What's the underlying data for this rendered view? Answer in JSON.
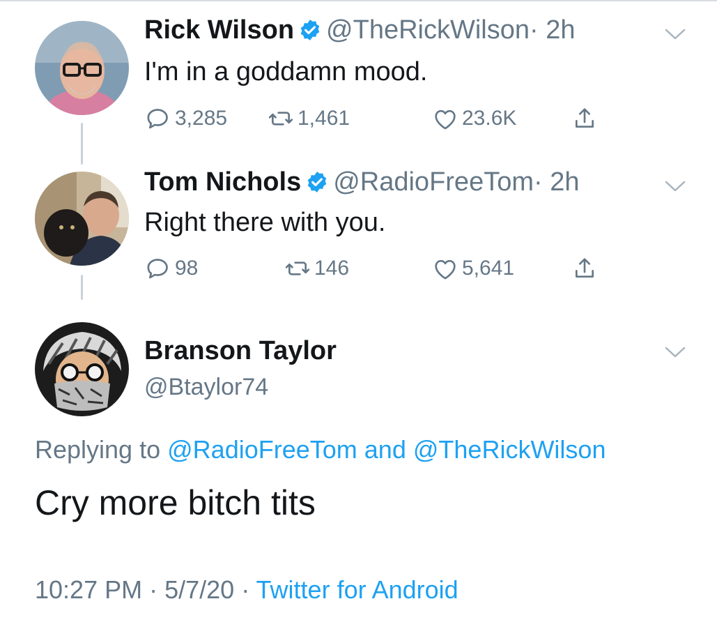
{
  "tweets": [
    {
      "name": "Rick Wilson",
      "handle": "@TheRickWilson",
      "time": "· 2h",
      "text": "I'm in a goddamn mood.",
      "replies": "3,285",
      "retweets": "1,461",
      "likes": "23.6K"
    },
    {
      "name": "Tom Nichols",
      "handle": "@RadioFreeTom",
      "time": "· 2h",
      "text": "Right there with you.",
      "replies": "98",
      "retweets": "146",
      "likes": "5,641"
    }
  ],
  "main_tweet": {
    "name": "Branson Taylor",
    "handle": "@Btaylor74",
    "replying_prefix": "Replying to",
    "reply_to_1": "@RadioFreeTom",
    "reply_conj": "and",
    "reply_to_2": "@TheRickWilson",
    "text": "Cry more bitch tits",
    "time": "10:27 PM",
    "date": "· 5/7/20 ·",
    "source": "Twitter for Android"
  },
  "colors": {
    "link": "#1da1f2",
    "secondary_text": "#657786",
    "primary_text": "#14171a",
    "thread_line": "#c9d1d8"
  },
  "icons": [
    "verified-badge-icon",
    "chevron-down-icon",
    "reply-icon",
    "retweet-icon",
    "like-icon",
    "share-icon"
  ]
}
